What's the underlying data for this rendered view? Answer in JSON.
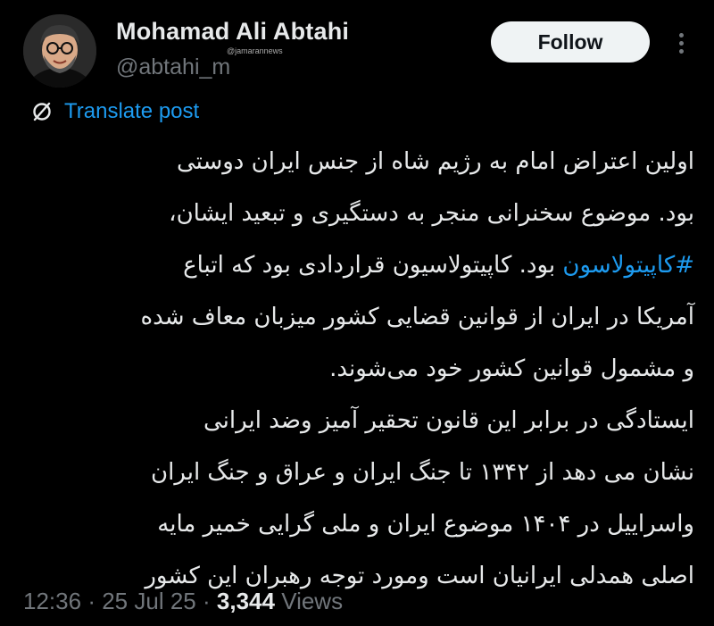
{
  "author": {
    "name": "Mohamad Ali Abtahi",
    "handle": "@abtahi_m",
    "watermark": "@jamarannews"
  },
  "actions": {
    "follow_label": "Follow",
    "more_icon": "more-horizontal-icon"
  },
  "translate": {
    "label": "Translate post",
    "icon": "translate-icon"
  },
  "post": {
    "line1": "اولین اعتراض امام به رژیم شاه از جنس ایران دوستی",
    "line2": "بود. موضوع سخنرانی منجر به دستگیری و تبعید ایشان،",
    "line3_hashtag": "#کاپیتولاسون",
    "line3_rest": " بود. کاپیتولاسیون قراردادی بود که اتباع",
    "line4": "آمریکا در ایران از قوانین قضایی کشور میزبان معاف شده",
    "line5": "و مشمول قوانین کشور خود می‌شوند.",
    "line6": "ایستادگی در برابر این قانون تحقیر آمیز وضد ایرانی",
    "line7": "نشان می دهد از ۱۳۴۲ تا جنگ ایران و عراق و جنگ ایران",
    "line8": "واسراییل در ۱۴۰۴ موضوع ایران و ملی گرایی خمیر مایه",
    "line9": "اصلی همدلی ایرانیان است ومورد توجه رهبران این کشور"
  },
  "meta": {
    "time": "12:36",
    "separator": "·",
    "date": "25 Jul 25",
    "views_count": "3,344",
    "views_label": "Views"
  },
  "colors": {
    "background": "#000000",
    "text": "#e7e9ea",
    "muted": "#71767b",
    "link": "#1d9bf0",
    "follow_bg": "#eff3f4"
  }
}
